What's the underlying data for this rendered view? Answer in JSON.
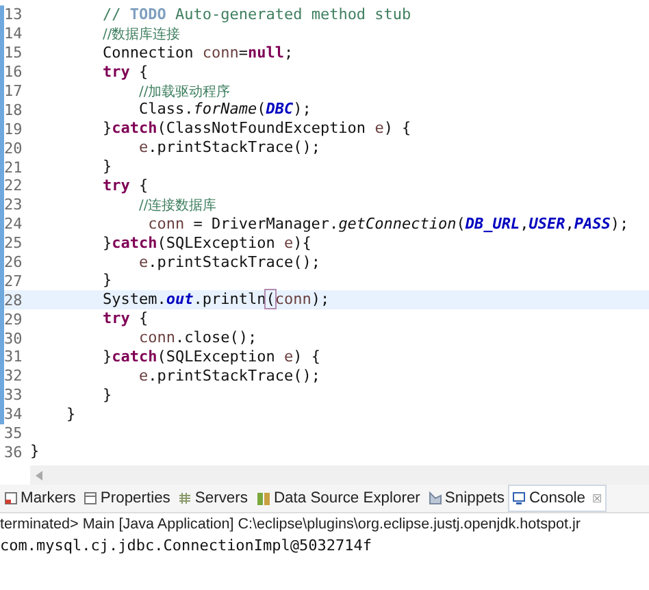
{
  "editor": {
    "lines": [
      {
        "number": "13",
        "current": false,
        "tokens": [
          {
            "kind": "comment",
            "text": "        // "
          },
          {
            "kind": "todo",
            "text": "TODO"
          },
          {
            "kind": "comment",
            "text": " Auto-generated method stub"
          }
        ]
      },
      {
        "number": "14",
        "current": false,
        "tokens": [
          {
            "kind": "comment-cjk",
            "text": "        //数据库连接"
          }
        ]
      },
      {
        "number": "15",
        "current": false,
        "tokens": [
          {
            "kind": "plain",
            "text": "        Connection "
          },
          {
            "kind": "local",
            "text": "conn"
          },
          {
            "kind": "plain",
            "text": "="
          },
          {
            "kind": "keyword",
            "text": "null"
          },
          {
            "kind": "plain",
            "text": ";"
          }
        ]
      },
      {
        "number": "16",
        "current": false,
        "tokens": [
          {
            "kind": "keyword",
            "text": "        try"
          },
          {
            "kind": "plain",
            "text": " {"
          }
        ]
      },
      {
        "number": "17",
        "current": false,
        "tokens": [
          {
            "kind": "comment-cjk",
            "text": "            //加载驱动程序"
          }
        ]
      },
      {
        "number": "18",
        "current": false,
        "tokens": [
          {
            "kind": "plain",
            "text": "            Class."
          },
          {
            "kind": "static-method",
            "text": "forName"
          },
          {
            "kind": "plain",
            "text": "("
          },
          {
            "kind": "field",
            "text": "DBC"
          },
          {
            "kind": "plain",
            "text": ");"
          }
        ]
      },
      {
        "number": "19",
        "current": false,
        "tokens": [
          {
            "kind": "plain",
            "text": "        }"
          },
          {
            "kind": "keyword",
            "text": "catch"
          },
          {
            "kind": "plain",
            "text": "(ClassNotFoundException "
          },
          {
            "kind": "local",
            "text": "e"
          },
          {
            "kind": "plain",
            "text": ") {"
          }
        ]
      },
      {
        "number": "20",
        "current": false,
        "tokens": [
          {
            "kind": "local",
            "text": "            e"
          },
          {
            "kind": "plain",
            "text": ".printStackTrace();"
          }
        ]
      },
      {
        "number": "21",
        "current": false,
        "tokens": [
          {
            "kind": "plain",
            "text": "        }"
          }
        ]
      },
      {
        "number": "22",
        "current": false,
        "tokens": [
          {
            "kind": "keyword",
            "text": "        try"
          },
          {
            "kind": "plain",
            "text": " {"
          }
        ]
      },
      {
        "number": "23",
        "current": false,
        "tokens": [
          {
            "kind": "comment-cjk",
            "text": "            //连接数据库"
          }
        ]
      },
      {
        "number": "24",
        "current": false,
        "tokens": [
          {
            "kind": "local",
            "text": "             conn"
          },
          {
            "kind": "plain",
            "text": " = DriverManager."
          },
          {
            "kind": "static-method",
            "text": "getConnection"
          },
          {
            "kind": "plain",
            "text": "("
          },
          {
            "kind": "field",
            "text": "DB_URL"
          },
          {
            "kind": "plain",
            "text": ","
          },
          {
            "kind": "field",
            "text": "USER"
          },
          {
            "kind": "plain",
            "text": ","
          },
          {
            "kind": "field",
            "text": "PASS"
          },
          {
            "kind": "plain",
            "text": ");"
          }
        ]
      },
      {
        "number": "25",
        "current": false,
        "tokens": [
          {
            "kind": "plain",
            "text": "        }"
          },
          {
            "kind": "keyword",
            "text": "catch"
          },
          {
            "kind": "plain",
            "text": "(SQLException "
          },
          {
            "kind": "local",
            "text": "e"
          },
          {
            "kind": "plain",
            "text": "){"
          }
        ]
      },
      {
        "number": "26",
        "current": false,
        "tokens": [
          {
            "kind": "local",
            "text": "            e"
          },
          {
            "kind": "plain",
            "text": ".printStackTrace();"
          }
        ]
      },
      {
        "number": "27",
        "current": false,
        "tokens": [
          {
            "kind": "plain",
            "text": "        }"
          }
        ]
      },
      {
        "number": "28",
        "current": true,
        "tokens": [
          {
            "kind": "plain",
            "text": "        System."
          },
          {
            "kind": "field",
            "text": "out"
          },
          {
            "kind": "plain",
            "text": ".println"
          },
          {
            "kind": "bracket-match",
            "text": "("
          },
          {
            "kind": "local",
            "text": "conn"
          },
          {
            "kind": "plain",
            "text": ");"
          }
        ]
      },
      {
        "number": "29",
        "current": false,
        "tokens": [
          {
            "kind": "keyword",
            "text": "        try"
          },
          {
            "kind": "plain",
            "text": " {"
          }
        ]
      },
      {
        "number": "30",
        "current": false,
        "tokens": [
          {
            "kind": "local",
            "text": "            conn"
          },
          {
            "kind": "plain",
            "text": ".close();"
          }
        ]
      },
      {
        "number": "31",
        "current": false,
        "tokens": [
          {
            "kind": "plain",
            "text": "        }"
          },
          {
            "kind": "keyword",
            "text": "catch"
          },
          {
            "kind": "plain",
            "text": "(SQLException "
          },
          {
            "kind": "local",
            "text": "e"
          },
          {
            "kind": "plain",
            "text": ") {"
          }
        ]
      },
      {
        "number": "32",
        "current": false,
        "tokens": [
          {
            "kind": "local",
            "text": "            e"
          },
          {
            "kind": "plain",
            "text": ".printStackTrace();"
          }
        ]
      },
      {
        "number": "33",
        "current": false,
        "tokens": [
          {
            "kind": "plain",
            "text": "        }"
          }
        ]
      },
      {
        "number": "34",
        "current": false,
        "tokens": [
          {
            "kind": "plain",
            "text": "    }"
          }
        ]
      },
      {
        "number": "35",
        "current": false
      },
      {
        "number": "36",
        "current": false,
        "tokens": [
          {
            "kind": "plain",
            "text": "}"
          }
        ]
      }
    ]
  },
  "tabs": [
    {
      "label": "Markers",
      "kind": "markers",
      "selected": false
    },
    {
      "label": "Properties",
      "kind": "properties",
      "selected": false
    },
    {
      "label": "Servers",
      "kind": "servers",
      "selected": false
    },
    {
      "label": "Data Source Explorer",
      "kind": "datasource",
      "selected": false
    },
    {
      "label": "Snippets",
      "kind": "snippets",
      "selected": false
    },
    {
      "label": "Console",
      "kind": "console",
      "selected": true,
      "close": "☒"
    }
  ],
  "console": {
    "header": "terminated> Main [Java Application] C:\\eclipse\\plugins\\org.eclipse.justj.openjdk.hotspot.jr",
    "output": "com.mysql.cj.jdbc.ConnectionImpl@5032714f"
  }
}
